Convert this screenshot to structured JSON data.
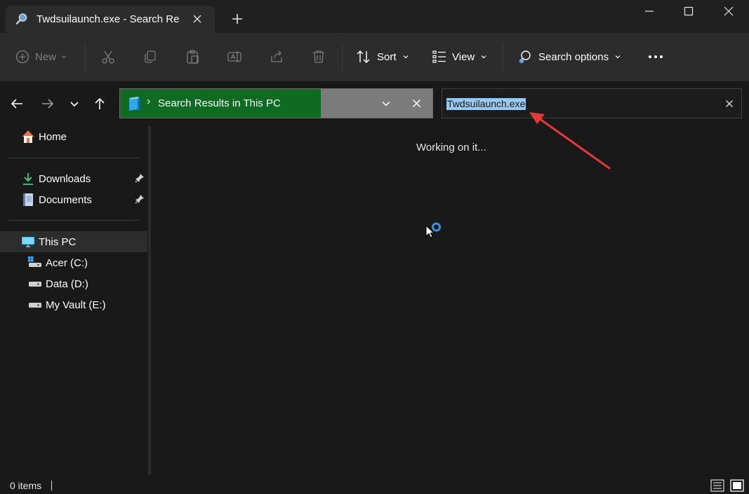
{
  "window": {
    "tab_title": "Twdsuilaunch.exe - Search Re",
    "icons": {
      "tab": "search-magnifier-icon",
      "new_tab": "plus-icon",
      "minimize": "minimize-icon",
      "maximize": "maximize-icon",
      "close": "close-icon"
    }
  },
  "toolbar": {
    "new_label": "New",
    "sort_label": "Sort",
    "view_label": "View",
    "search_options_label": "Search options",
    "icons": [
      "cut-icon",
      "copy-icon",
      "paste-icon",
      "rename-icon",
      "share-icon",
      "delete-icon",
      "more-icon"
    ]
  },
  "navigation": {
    "breadcrumb_text": "Search Results in This PC",
    "breadcrumb_separator": "›",
    "search_value": "Twdsuilaunch.exe",
    "icons": [
      "back-arrow-icon",
      "forward-arrow-icon",
      "recent-locations-chevron-icon",
      "up-arrow-icon"
    ]
  },
  "sidebar": {
    "home": "Home",
    "quick_access": [
      {
        "label": "Downloads",
        "icon": "download-arrow-icon",
        "pinned": true
      },
      {
        "label": "Documents",
        "icon": "document-icon",
        "pinned": true
      }
    ],
    "this_pc": "This PC",
    "drives": [
      {
        "label": "Acer (C:)",
        "icon": "system-drive-icon"
      },
      {
        "label": "Data (D:)",
        "icon": "drive-icon"
      },
      {
        "label": "My Vault (E:)",
        "icon": "drive-icon"
      }
    ]
  },
  "content": {
    "status_message": "Working on it..."
  },
  "statusbar": {
    "item_count": "0 items"
  },
  "colors": {
    "address_highlight": "#0f6b22",
    "selection": "#99c9ef",
    "annotation_arrow": "#e53935",
    "loading_spinner": "#3b8eea"
  }
}
